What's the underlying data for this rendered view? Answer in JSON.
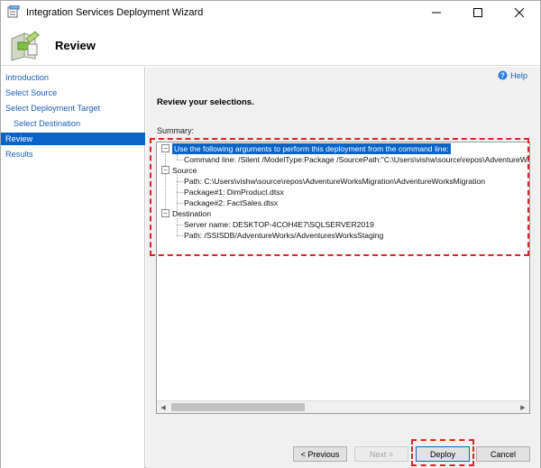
{
  "window": {
    "title": "Integration Services Deployment Wizard"
  },
  "header": {
    "title": "Review"
  },
  "sidebar": {
    "items": [
      {
        "label": "Introduction",
        "active": false
      },
      {
        "label": "Select Source",
        "active": false
      },
      {
        "label": "Select Deployment Target",
        "active": false
      },
      {
        "label": "Select Destination",
        "active": false
      },
      {
        "label": "Review",
        "active": true
      },
      {
        "label": "Results",
        "active": false
      }
    ]
  },
  "main": {
    "help_label": "Help",
    "heading": "Review your selections.",
    "summary_label": "Summary:",
    "tree": {
      "cmd_root": "Use the following arguments to perform this deployment from the command line:",
      "cmd_line": "Command line: /Silent /ModelType:Package /SourcePath:\"C:\\Users\\vishw\\source\\repos\\AdventureWorksMigration\\AdventureWorksMigration\\DimProduct.dtsx\"",
      "source_root": "Source",
      "source_path": "Path: C:\\Users\\vishw\\source\\repos\\AdventureWorksMigration\\AdventureWorksMigration",
      "package1": "Package#1: DimProduct.dtsx",
      "package2": "Package#2: FactSales.dtsx",
      "dest_root": "Destination",
      "server_name": "Server name: DESKTOP-4COH4E7\\SQLSERVER2019",
      "dest_path": "Path: /SSISDB/AdventureWorks/AdventuresWorksStaging",
      "toggle_symbol": "−"
    }
  },
  "footer": {
    "previous_label": "< Previous",
    "next_label": "Next >",
    "deploy_label": "Deploy",
    "cancel_label": "Cancel"
  },
  "colors": {
    "accent": "#0a63c7",
    "link": "#1a5fb4",
    "annotation": "#d9252a"
  }
}
